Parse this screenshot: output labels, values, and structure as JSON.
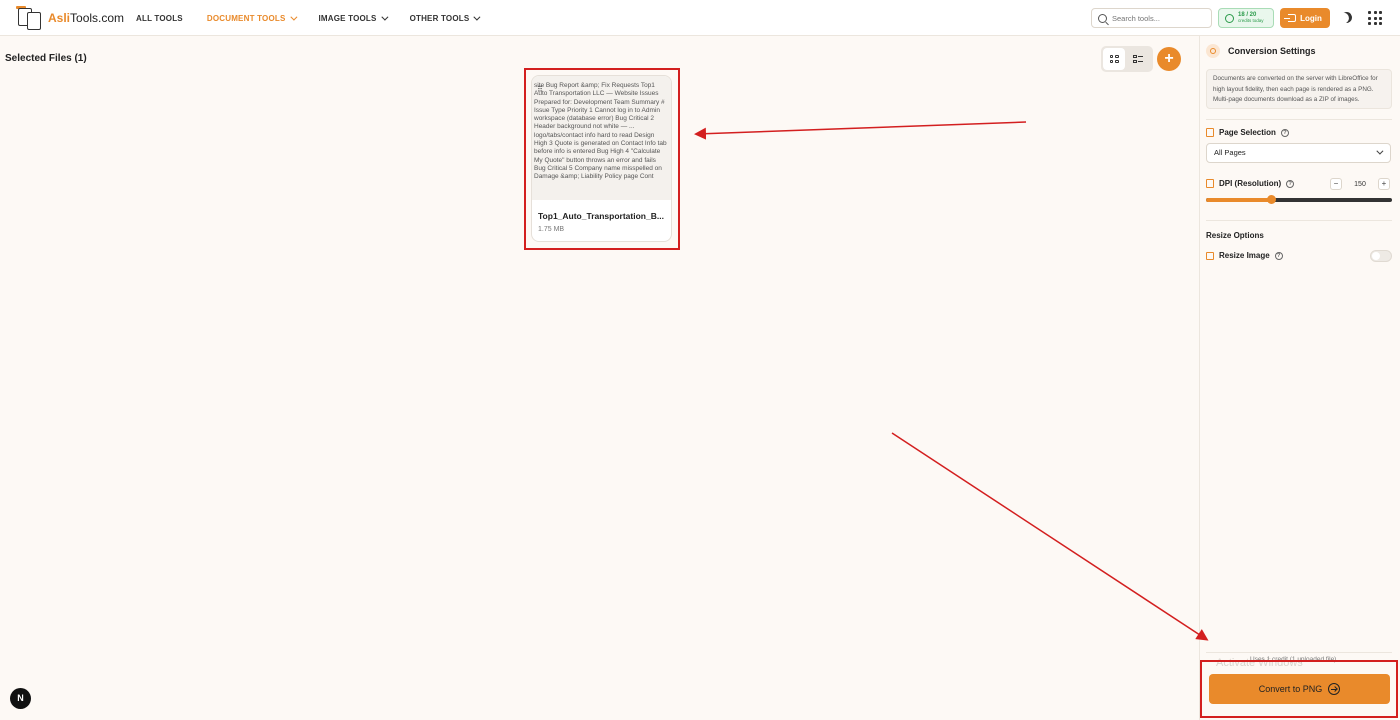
{
  "header": {
    "logo_accent": "Asli",
    "logo_rest": "Tools.com",
    "nav": [
      {
        "label": "ALL TOOLS"
      },
      {
        "label": "DOCUMENT TOOLS"
      },
      {
        "label": "IMAGE TOOLS"
      },
      {
        "label": "OTHER TOOLS"
      }
    ],
    "search_placeholder": "Search tools...",
    "credits_count": "18 / 20",
    "credits_label": "credits today",
    "login_label": "Login"
  },
  "main": {
    "selected_title": "Selected Files (1)",
    "file": {
      "preview_text": "site Bug Report &amp; Fix Requests Top1 Auto Transportation LLC — Website Issues Prepared for: Development Team Summary # Issue Type Priority 1 Cannot log in to Admin workspace (database error) Bug Critical 2 Header background not white — ... logo/tabs/contact info hard to read Design High 3 Quote is generated on Contact Info tab before info is entered Bug High 4 \"Calculate My Quote\" button throws an error and fails Bug Critical 5 Company name misspelled on Damage &amp; Liability Policy page Cont",
      "name": "Top1_Auto_Transportation_B...",
      "size": "1.75 MB"
    },
    "badge": "N"
  },
  "sidebar": {
    "title": "Conversion Settings",
    "info": "Documents are converted on the server with LibreOffice for high layout fidelity, then each page is rendered as a PNG. Multi-page documents download as a ZIP of images.",
    "page_selection_label": "Page Selection",
    "page_selection_value": "All Pages",
    "dpi_label": "DPI (Resolution)",
    "dpi_value": "150",
    "dpi_fraction": 0.35,
    "resize_heading": "Resize Options",
    "resize_label": "Resize Image",
    "uses_note": "Uses 1 credit (1 uploaded file)",
    "watermark": "Activate Windows",
    "convert_label": "Convert to PNG"
  },
  "colors": {
    "accent": "#e98a2b",
    "highlight": "#d31f1f"
  }
}
